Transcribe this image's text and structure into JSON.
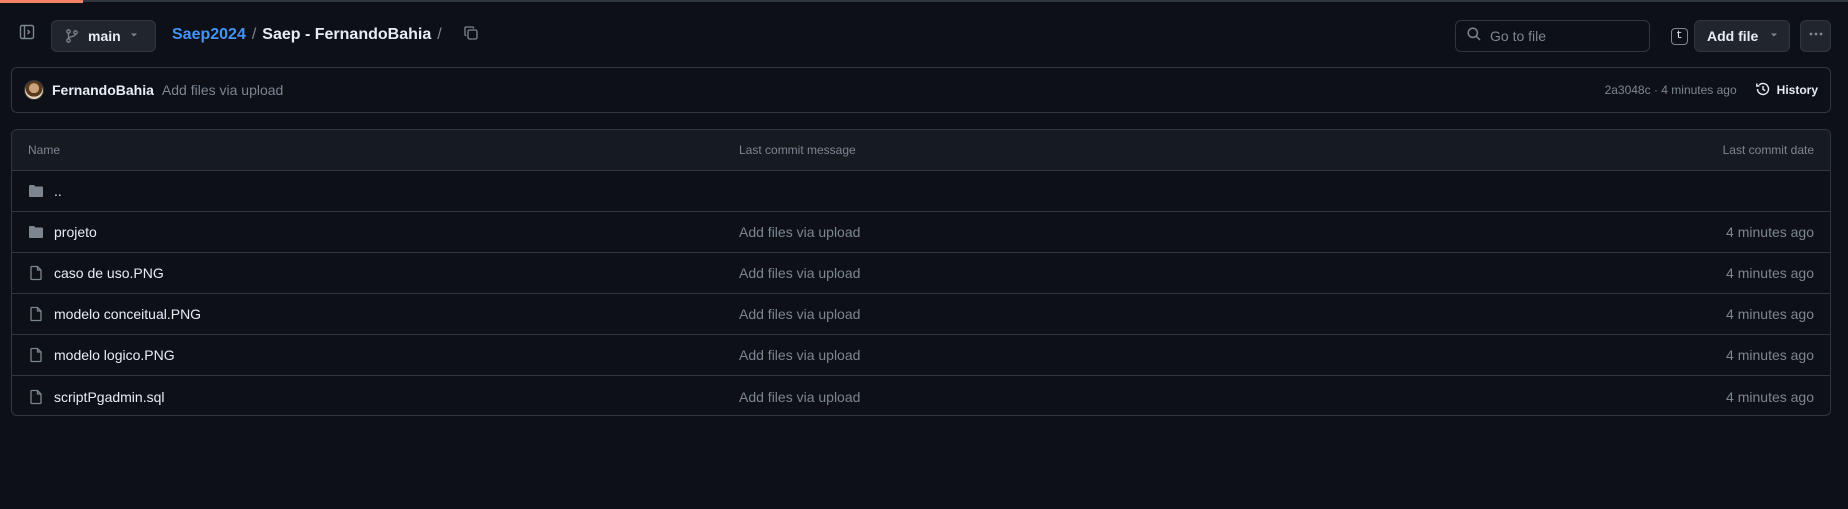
{
  "header": {
    "branch": "main",
    "breadcrumb": {
      "repo": "Saep2024",
      "separator": "/",
      "folder": "Saep - FernandoBahia",
      "trailing_sep": "/"
    },
    "search": {
      "placeholder": "Go to file",
      "shortcut": "t"
    },
    "add_file_label": "Add file"
  },
  "commit": {
    "author": "FernandoBahia",
    "message": "Add files via upload",
    "meta": "2a3048c · 4 minutes ago",
    "history_label": "History"
  },
  "table": {
    "headers": {
      "name": "Name",
      "message": "Last commit message",
      "date": "Last commit date"
    },
    "rows": [
      {
        "type": "folder",
        "name": "..",
        "message": "",
        "date": ""
      },
      {
        "type": "folder",
        "name": "projeto",
        "message": "Add files via upload",
        "date": "4 minutes ago"
      },
      {
        "type": "file",
        "name": "caso de uso.PNG",
        "message": "Add files via upload",
        "date": "4 minutes ago"
      },
      {
        "type": "file",
        "name": "modelo conceitual.PNG",
        "message": "Add files via upload",
        "date": "4 minutes ago"
      },
      {
        "type": "file",
        "name": "modelo logico.PNG",
        "message": "Add files via upload",
        "date": "4 minutes ago"
      },
      {
        "type": "file",
        "name": "scriptPgadmin.sql",
        "message": "Add files via upload",
        "date": "4 minutes ago"
      }
    ]
  },
  "colors": {
    "background": "#0d1117",
    "border": "#30363d",
    "link": "#4493f8",
    "muted": "#7d8590",
    "text": "#e6edf3",
    "accent": "#f78166"
  }
}
